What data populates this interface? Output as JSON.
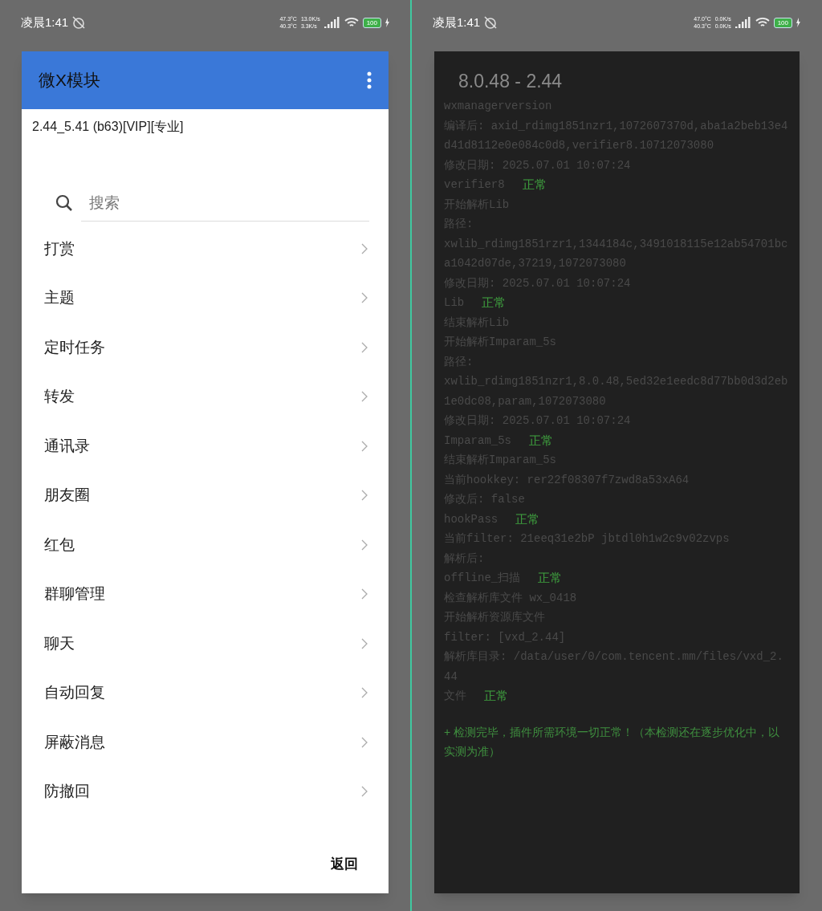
{
  "screens": [
    {
      "status_bar": {
        "time": "凌晨1:41",
        "temps": [
          "47.3°C",
          "40.3°C"
        ],
        "speeds": [
          "13.0K/s",
          "3.3K/s"
        ],
        "battery": "100"
      },
      "dialog": {
        "kind": "menu",
        "title": "微X模块",
        "subtitle": "2.44_5.41 (b63)[VIP][专业]",
        "search": {
          "placeholder": "搜索"
        },
        "items": [
          "打赏",
          "主题",
          "定时任务",
          "转发",
          "通讯录",
          "朋友圈",
          "红包",
          "群聊管理",
          "聊天",
          "自动回复",
          "屏蔽消息",
          "防撤回"
        ],
        "back_button": "返回"
      }
    },
    {
      "status_bar": {
        "time": "凌晨1:41",
        "temps": [
          "47.0°C",
          "40.3°C"
        ],
        "speeds": [
          "0.0K/s",
          "0.0K/s"
        ],
        "battery": "100"
      },
      "dialog": {
        "kind": "log",
        "title": "8.0.48 - 2.44",
        "lines": [
          {
            "text": "wxmanagerversion"
          },
          {
            "text": "编译后: axid_rdimg1851nzr1,1072607370d,aba1a2beb13e4d41d8112e0e084c0d8,verifier8.10712073080"
          },
          {
            "text": "修改日期: 2025.07.01 10:07:24"
          },
          {
            "text": "verifier8",
            "status": "正常"
          },
          {
            "text": "开始解析Lib"
          },
          {
            "text": "路径:"
          },
          {
            "text": "xwlib_rdimg1851rzr1,1344184c,3491018115e12ab54701bca1042d07de,37219,1072073080"
          },
          {
            "text": "修改日期: 2025.07.01 10:07:24"
          },
          {
            "text": "Lib",
            "status": "正常"
          },
          {
            "text": "结束解析Lib"
          },
          {
            "text": "开始解析Imparam_5s"
          },
          {
            "text": "路径:"
          },
          {
            "text": "xwlib_rdimg1851nzr1,8.0.48,5ed32e1eedc8d77bb0d3d2eb1e0dc08,param,1072073080"
          },
          {
            "text": "修改日期: 2025.07.01 10:07:24"
          },
          {
            "text": "Imparam_5s",
            "status": "正常"
          },
          {
            "text": "结束解析Imparam_5s"
          },
          {
            "text": "当前hookkey: rer22f08307f7zwd8a53xA64"
          },
          {
            "text": "修改后: false"
          },
          {
            "text": "hookPass",
            "status": "正常"
          },
          {
            "text": "当前filter: 21eeq31e2bP jbtdl0h1w2c9v02zvps"
          },
          {
            "text": "解析后:"
          },
          {
            "text": "offline_扫描",
            "status": "正常"
          },
          {
            "text": "检查解析库文件 wx_0418"
          },
          {
            "text": "开始解析资源库文件"
          },
          {
            "text": "filter: [vxd_2.44]"
          },
          {
            "text": "解析库目录: /data/user/0/com.tencent.mm/files/vxd_2.44"
          },
          {
            "text": "文件",
            "status": "正常"
          }
        ],
        "summary": "+ 检测完毕，插件所需环境一切正常！（本检测还在逐步优化中，以实测为准）"
      }
    }
  ]
}
